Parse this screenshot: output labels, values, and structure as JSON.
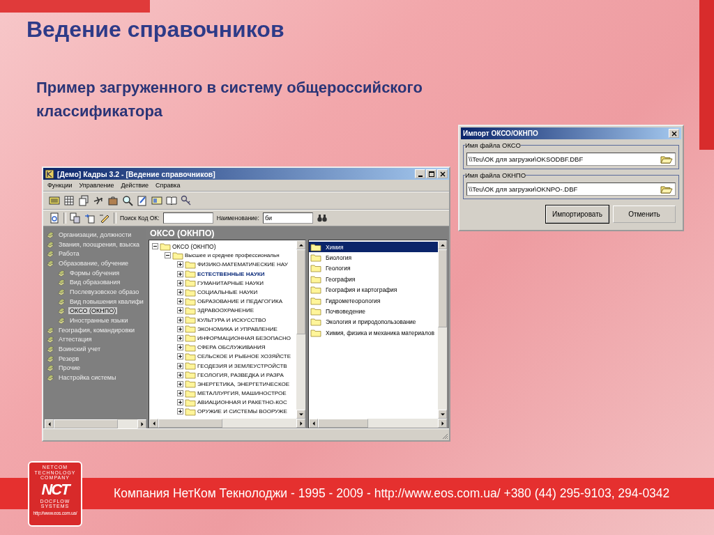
{
  "slide": {
    "title": "Ведение справочников",
    "subtitle": "Пример загруженного в систему общероссийского классификатора"
  },
  "main_window": {
    "title": "[Демо] Кадры 3.2 - [Ведение справочников]",
    "menu": [
      {
        "label": "Функции"
      },
      {
        "label": "Управление"
      },
      {
        "label": "Действие"
      },
      {
        "label": "Справка"
      }
    ],
    "search": {
      "code_label": "Поиск Код ОК:",
      "name_label": "Наименование:",
      "name_value": "би"
    },
    "sidebar": [
      {
        "label": "Организации, должности",
        "selected": false
      },
      {
        "label": "Звания, поощрения, взыска",
        "selected": false
      },
      {
        "label": "Работа",
        "selected": false
      },
      {
        "label": "Образование, обучение",
        "selected": false,
        "children": [
          {
            "label": "Формы обучения",
            "selected": false
          },
          {
            "label": "Вид образования",
            "selected": false
          },
          {
            "label": "Послевузовское образо",
            "selected": false
          },
          {
            "label": "Вид повышения квалифи",
            "selected": false
          },
          {
            "label": "ОКСО (ОКНПО)",
            "selected": true
          },
          {
            "label": "Иностранные языки",
            "selected": false
          }
        ]
      },
      {
        "label": "География, командировки",
        "selected": false
      },
      {
        "label": "Аттестация",
        "selected": false
      },
      {
        "label": "Воинский учет",
        "selected": false
      },
      {
        "label": "Резерв",
        "selected": false
      },
      {
        "label": "Прочие",
        "selected": false
      },
      {
        "label": "Настройка системы",
        "selected": false
      }
    ],
    "panel_title": "ОКСО (ОКНПО)",
    "tree": [
      {
        "label": "ОКСО (ОКНПО)",
        "expanded": true,
        "selected": false,
        "children": [
          {
            "label": "Высшее и среднее профессиональн",
            "expanded": true,
            "selected": false,
            "children": [
              {
                "label": "ФИЗИКО-МАТЕМАТИЧЕСКИЕ НАУ",
                "expanded": false,
                "selected": false
              },
              {
                "label": "ЕСТЕСТВЕННЫЕ НАУКИ",
                "expanded": false,
                "selected": true
              },
              {
                "label": "ГУМАНИТАРНЫЕ НАУКИ",
                "expanded": false,
                "selected": false
              },
              {
                "label": "СОЦИАЛЬНЫЕ НАУКИ",
                "expanded": false,
                "selected": false
              },
              {
                "label": "ОБРАЗОВАНИЕ И ПЕДАГОГИКА",
                "expanded": false,
                "selected": false
              },
              {
                "label": "ЗДРАВООХРАНЕНИЕ",
                "expanded": false,
                "selected": false
              },
              {
                "label": "КУЛЬТУРА И ИСКУССТВО",
                "expanded": false,
                "selected": false
              },
              {
                "label": "ЭКОНОМИКА И УПРАВЛЕНИЕ",
                "expanded": false,
                "selected": false
              },
              {
                "label": "ИНФОРМАЦИОННАЯ БЕЗОПАСНО",
                "expanded": false,
                "selected": false
              },
              {
                "label": "СФЕРА ОБСЛУЖИВАНИЯ",
                "expanded": false,
                "selected": false
              },
              {
                "label": "СЕЛЬСКОЕ И РЫБНОЕ ХОЗЯЙСТЕ",
                "expanded": false,
                "selected": false
              },
              {
                "label": "ГЕОДЕЗИЯ И ЗЕМЛЕУСТРОЙСТВ",
                "expanded": false,
                "selected": false
              },
              {
                "label": "ГЕОЛОГИЯ, РАЗВЕДКА И РАЗРА",
                "expanded": false,
                "selected": false
              },
              {
                "label": "ЭНЕРГЕТИКА, ЭНЕРГЕТИЧЕСКОЕ",
                "expanded": false,
                "selected": false
              },
              {
                "label": "МЕТАЛЛУРГИЯ, МАШИНОСТРОЕ",
                "expanded": false,
                "selected": false
              },
              {
                "label": "АВИАЦИОННАЯ И РАКЕТНО-КОС",
                "expanded": false,
                "selected": false
              },
              {
                "label": "ОРУЖИЕ И СИСТЕМЫ ВООРУЖЕ",
                "expanded": false,
                "selected": false
              }
            ]
          }
        ]
      }
    ],
    "list": [
      {
        "label": "Химия",
        "selected": true
      },
      {
        "label": "Биология",
        "selected": false
      },
      {
        "label": "Геология",
        "selected": false
      },
      {
        "label": "География",
        "selected": false
      },
      {
        "label": "География и картография",
        "selected": false
      },
      {
        "label": "Гидрометеорология",
        "selected": false
      },
      {
        "label": "Почвоведение",
        "selected": false
      },
      {
        "label": "Экология и природопользование",
        "selected": false
      },
      {
        "label": "Химия, физика и механика материалов",
        "selected": false
      }
    ]
  },
  "dialog": {
    "title": "Импорт ОКСО/ОКНПО",
    "fields": [
      {
        "label": "Имя файла ОКСО",
        "value": "\\\\Teu\\ОК для загрузки\\OKSODBF.DBF"
      },
      {
        "label": "Имя файла ОКНПО",
        "value": "\\\\Teu\\ОК для загрузки\\OKNPO-.DBF"
      }
    ],
    "buttons": [
      {
        "label": "Импортировать",
        "default": true
      },
      {
        "label": "Отменить",
        "default": false
      }
    ]
  },
  "footer": {
    "text": "Компания НетКом Текнолоджи - 1995 - 2009 - http://www.eos.com.ua/ +380 (44) 295-9103, 294-0342",
    "logo": {
      "top": [
        "NETCOM",
        "TECHNOLOGY",
        "COMPANY"
      ],
      "mark": "NCT",
      "bottom": [
        "DOCFLOW",
        "SYSTEMS"
      ],
      "url": "http://www.eos.com.ua/"
    }
  }
}
